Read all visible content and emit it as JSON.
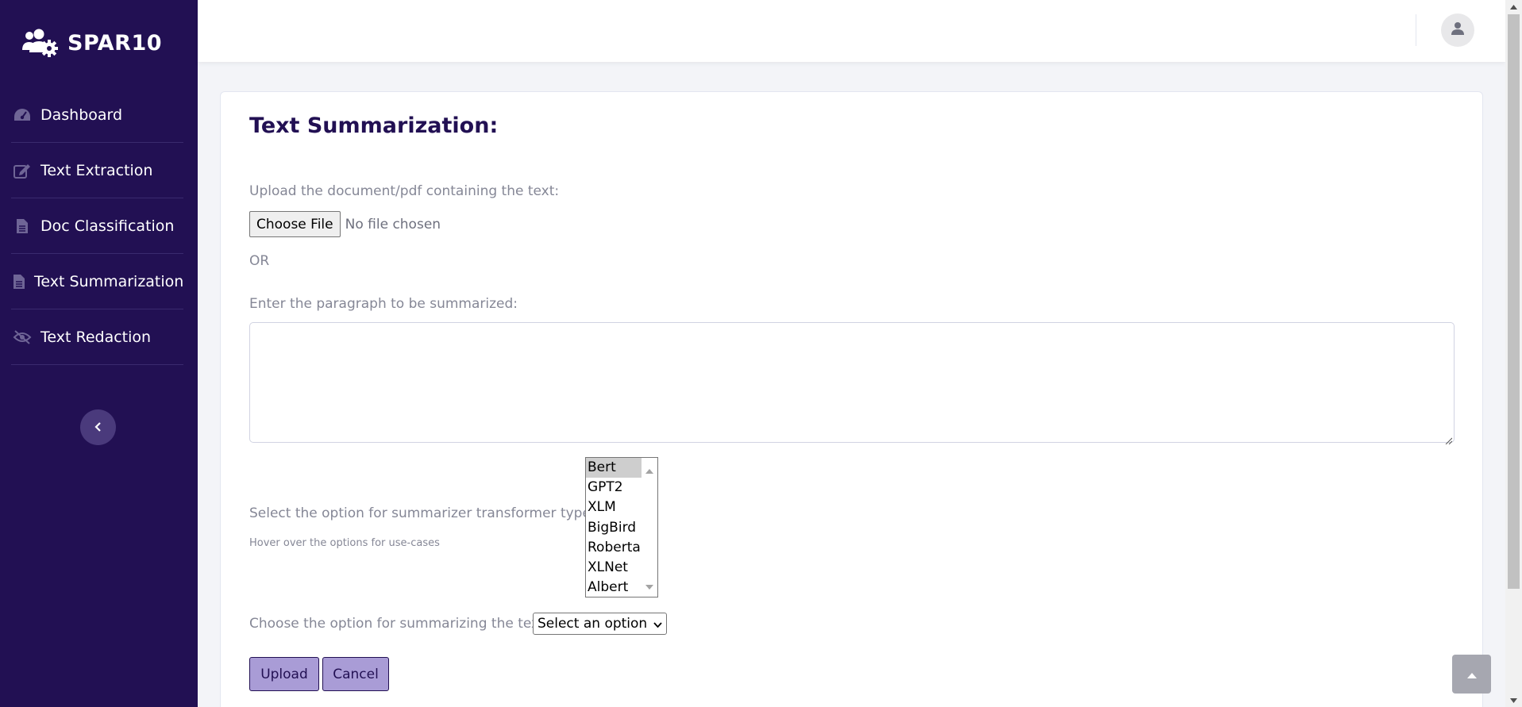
{
  "brand": {
    "name": "SPAR10",
    "icon": "users-gear-icon"
  },
  "sidebar": {
    "items": [
      {
        "label": "Dashboard",
        "icon": "tachometer-icon"
      },
      {
        "label": "Text Extraction",
        "icon": "edit-icon"
      },
      {
        "label": "Doc Classification",
        "icon": "file-alt-icon"
      },
      {
        "label": "Text Summarization",
        "icon": "file-alt-icon"
      },
      {
        "label": "Text Redaction",
        "icon": "eye-slash-icon"
      }
    ],
    "collapse_icon": "chevron-left-icon"
  },
  "topbar": {
    "avatar_icon": "user-icon"
  },
  "main": {
    "title": "Text Summarization:",
    "upload_label": "Upload the document/pdf containing the text:",
    "file_button": "Choose File",
    "file_status": "No file chosen",
    "or_text": "OR",
    "paragraph_label": "Enter the paragraph to be summarized:",
    "paragraph_value": "",
    "transformer_label": "Select the option for summarizer transformer type:",
    "transformer_hint": "Hover over the options for use-cases",
    "transformer_options": [
      "Bert",
      "GPT2",
      "XLM",
      "BigBird",
      "Roberta",
      "XLNet",
      "Albert"
    ],
    "transformer_selected": "Bert",
    "method_label": "Choose the option for summarizing the text:",
    "method_value": "Select an option",
    "upload_button": "Upload",
    "cancel_button": "Cancel"
  },
  "colors": {
    "sidebar_bg": "#221053",
    "title": "#221053",
    "button_bg": "#a99cd6",
    "muted_text": "#858796"
  }
}
